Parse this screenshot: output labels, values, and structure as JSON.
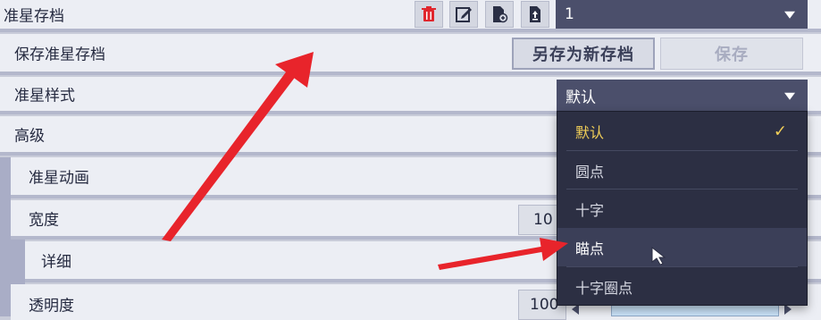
{
  "rows": {
    "preset": {
      "label": "准星存档",
      "select_value": "1"
    },
    "save": {
      "label": "保存准星存档",
      "save_as_new": "另存为新存档",
      "save": "保存"
    },
    "style": {
      "label": "准星样式",
      "select_value": "默认"
    },
    "advanced": {
      "label": "高级"
    },
    "animation": {
      "label": "准星动画"
    },
    "width": {
      "label": "宽度",
      "value": "10"
    },
    "detail": {
      "label": "详细"
    },
    "opacity": {
      "label": "透明度",
      "value": "100"
    }
  },
  "dropdown": {
    "items": [
      {
        "label": "默认",
        "selected": true
      },
      {
        "label": "圆点",
        "selected": false
      },
      {
        "label": "十字",
        "selected": false
      },
      {
        "label": "瞄点",
        "selected": false,
        "hover": true
      },
      {
        "label": "十字圈点",
        "selected": false
      }
    ],
    "check_glyph": "✓"
  },
  "icons": [
    "trash-icon",
    "edit-icon",
    "import-file-icon",
    "export-file-icon",
    "chevron-down-icon",
    "checkmark-icon",
    "mouse-cursor-icon"
  ],
  "colors": {
    "accent_selected": "#f2cf58",
    "dropdown_bg": "#2c2f43",
    "select_bg": "#4b4f6b",
    "annotation_arrow": "#e8242b",
    "trash_red": "#e0262d"
  }
}
